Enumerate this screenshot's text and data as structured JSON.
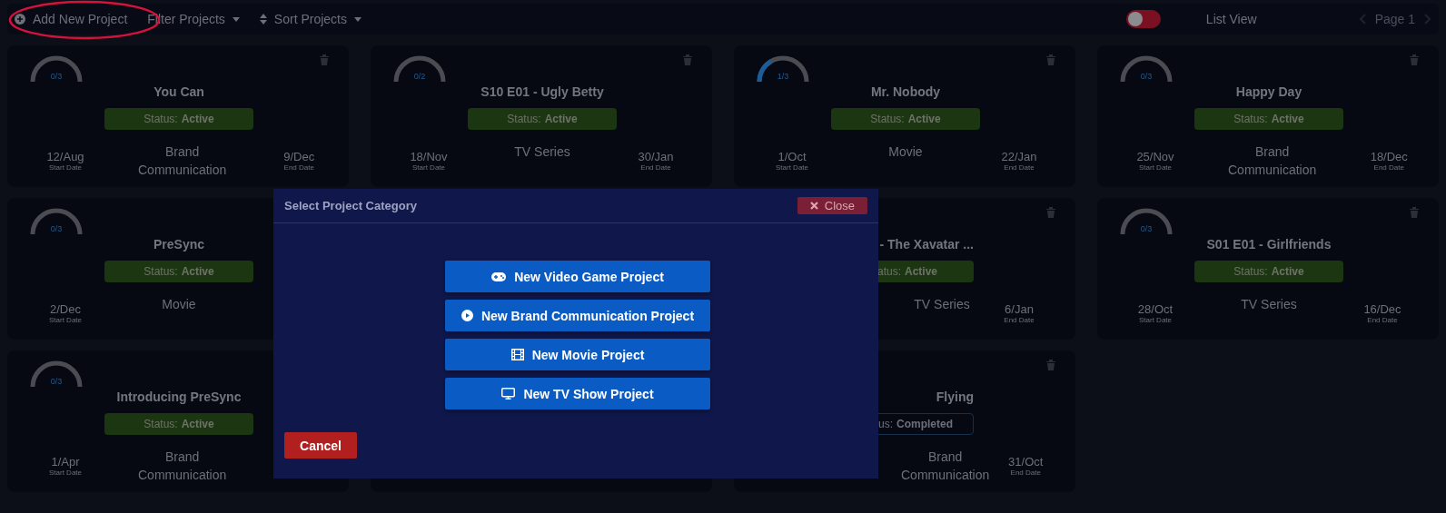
{
  "toolbar": {
    "add_button": "Add New Project",
    "filter_button": "Filter Projects",
    "sort_button": "Sort Projects",
    "list_view": {
      "label": "List View",
      "on": false
    },
    "pager": {
      "label": "Page 1"
    }
  },
  "projects": [
    {
      "progress": {
        "label": "0/3"
      },
      "title": "You Can",
      "status": {
        "kind": "active",
        "label": "Status:",
        "value": "Active"
      },
      "start": {
        "date": "12/Aug",
        "label": "Start Date"
      },
      "category": "Brand Communication",
      "end": {
        "date": "9/Dec",
        "label": "End Date"
      }
    },
    {
      "progress": {
        "label": "0/2"
      },
      "title": "S10 E01 - Ugly Betty",
      "status": {
        "kind": "active",
        "label": "Status:",
        "value": "Active"
      },
      "start": {
        "date": "18/Nov",
        "label": "Start Date"
      },
      "category": "TV Series",
      "end": {
        "date": "30/Jan",
        "label": "End Date"
      }
    },
    {
      "progress": {
        "label": "1/3"
      },
      "title": "Mr. Nobody",
      "status": {
        "kind": "active",
        "label": "Status:",
        "value": "Active"
      },
      "start": {
        "date": "1/Oct",
        "label": "Start Date"
      },
      "category": "Movie",
      "end": {
        "date": "22/Jan",
        "label": "End Date"
      }
    },
    {
      "progress": {
        "label": "0/3"
      },
      "title": "Happy Day",
      "status": {
        "kind": "active",
        "label": "Status:",
        "value": "Active"
      },
      "start": {
        "date": "25/Nov",
        "label": "Start Date"
      },
      "category": "Brand Communication",
      "end": {
        "date": "18/Dec",
        "label": "End Date"
      }
    },
    {
      "progress": {
        "label": "0/3"
      },
      "title": "PreSync",
      "status": {
        "kind": "active",
        "label": "Status:",
        "value": "Active"
      },
      "start": {
        "date": "2/Dec",
        "label": "Start Date"
      },
      "category": "Movie"
    },
    {
      "title": "- The Xavatar ...",
      "status": {
        "kind": "active",
        "label": "atus:",
        "value": "Active"
      },
      "category": "TV Series",
      "end": {
        "date": "6/Jan",
        "label": "End Date"
      }
    },
    {
      "progress": {
        "label": "0/3"
      },
      "title": "S01 E01 - Girlfriends",
      "status": {
        "kind": "active",
        "label": "Status:",
        "value": "Active"
      },
      "start": {
        "date": "28/Oct",
        "label": "Start Date"
      },
      "category": "TV Series",
      "end": {
        "date": "16/Dec",
        "label": "End Date"
      }
    },
    {
      "progress": {
        "label": "0/3"
      },
      "title": "Introducing PreSync",
      "status": {
        "kind": "active",
        "label": "Status:",
        "value": "Active"
      },
      "start": {
        "date": "1/Apr",
        "label": "Start Date"
      },
      "category": "Brand Communication"
    },
    {
      "kind": "hidden"
    },
    {
      "title": "Flying",
      "status": {
        "kind": "completed",
        "label": "us:",
        "value": "Completed"
      },
      "category": "Brand Communication",
      "end": {
        "date": "31/Oct",
        "label": "End Date"
      }
    }
  ],
  "dialog": {
    "title": "Select Project Category",
    "close_button": "Close",
    "options": [
      {
        "kind": "gamepad",
        "label": "New Video Game Project"
      },
      {
        "kind": "play",
        "label": "New Brand Communication Project"
      },
      {
        "kind": "film",
        "label": "New Movie Project"
      },
      {
        "kind": "monitor",
        "label": "New TV Show Project"
      }
    ],
    "cancel_button": "Cancel"
  }
}
